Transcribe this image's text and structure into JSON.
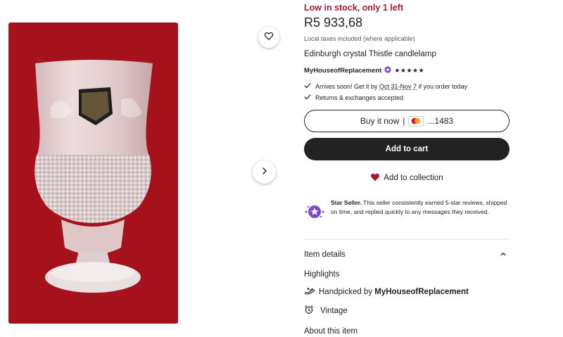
{
  "product": {
    "stock_notice": "Low in stock, only 1 left",
    "price": "R5 933,68",
    "taxes_note": "Local taxes included (where applicable)",
    "title": "Edinburgh crystal Thistle candlelamp",
    "shop_name": "MyHouseofReplacement",
    "rating_stars": "★★★★★",
    "rating": 5
  },
  "delivery": {
    "arrives_prefix": "Arrives soon! Get it by ",
    "arrives_dates": "Oct 31-Nov 7",
    "arrives_suffix": " if you order today",
    "returns": "Returns & exchanges accepted"
  },
  "actions": {
    "buy_now_label": "Buy it now",
    "buy_now_separator": "|",
    "card_last_digits": "...1483",
    "add_to_cart_label": "Add to cart",
    "add_to_collection_label": "Add to collection"
  },
  "star_seller": {
    "title": "Star Seller.",
    "description": " This seller consistently earned 5-star reviews, shipped on time, and replied quickly to any messages they received."
  },
  "item_details": {
    "section_label": "Item details",
    "highlights_label": "Highlights",
    "handpicked_prefix": "Handpicked by ",
    "handpicked_shop": "MyHouseofReplacement",
    "vintage_label": "Vintage",
    "about_label": "About this item"
  },
  "icons": {
    "favorite": "heart-outline-icon",
    "next": "chevron-right-icon",
    "check": "check-icon",
    "card": "mastercard-icon",
    "collection": "heart-filled-icon",
    "star_seller": "star-seller-badge-icon",
    "collapse": "chevron-up-icon",
    "handpicked": "hand-icon",
    "vintage": "alarm-clock-icon"
  },
  "colors": {
    "accent_red": "#a61a2e",
    "button_dark": "#222222",
    "image_background": "#a5121c",
    "star_seller_purple": "#7f4bc4",
    "collection_heart": "#a61a2e"
  }
}
